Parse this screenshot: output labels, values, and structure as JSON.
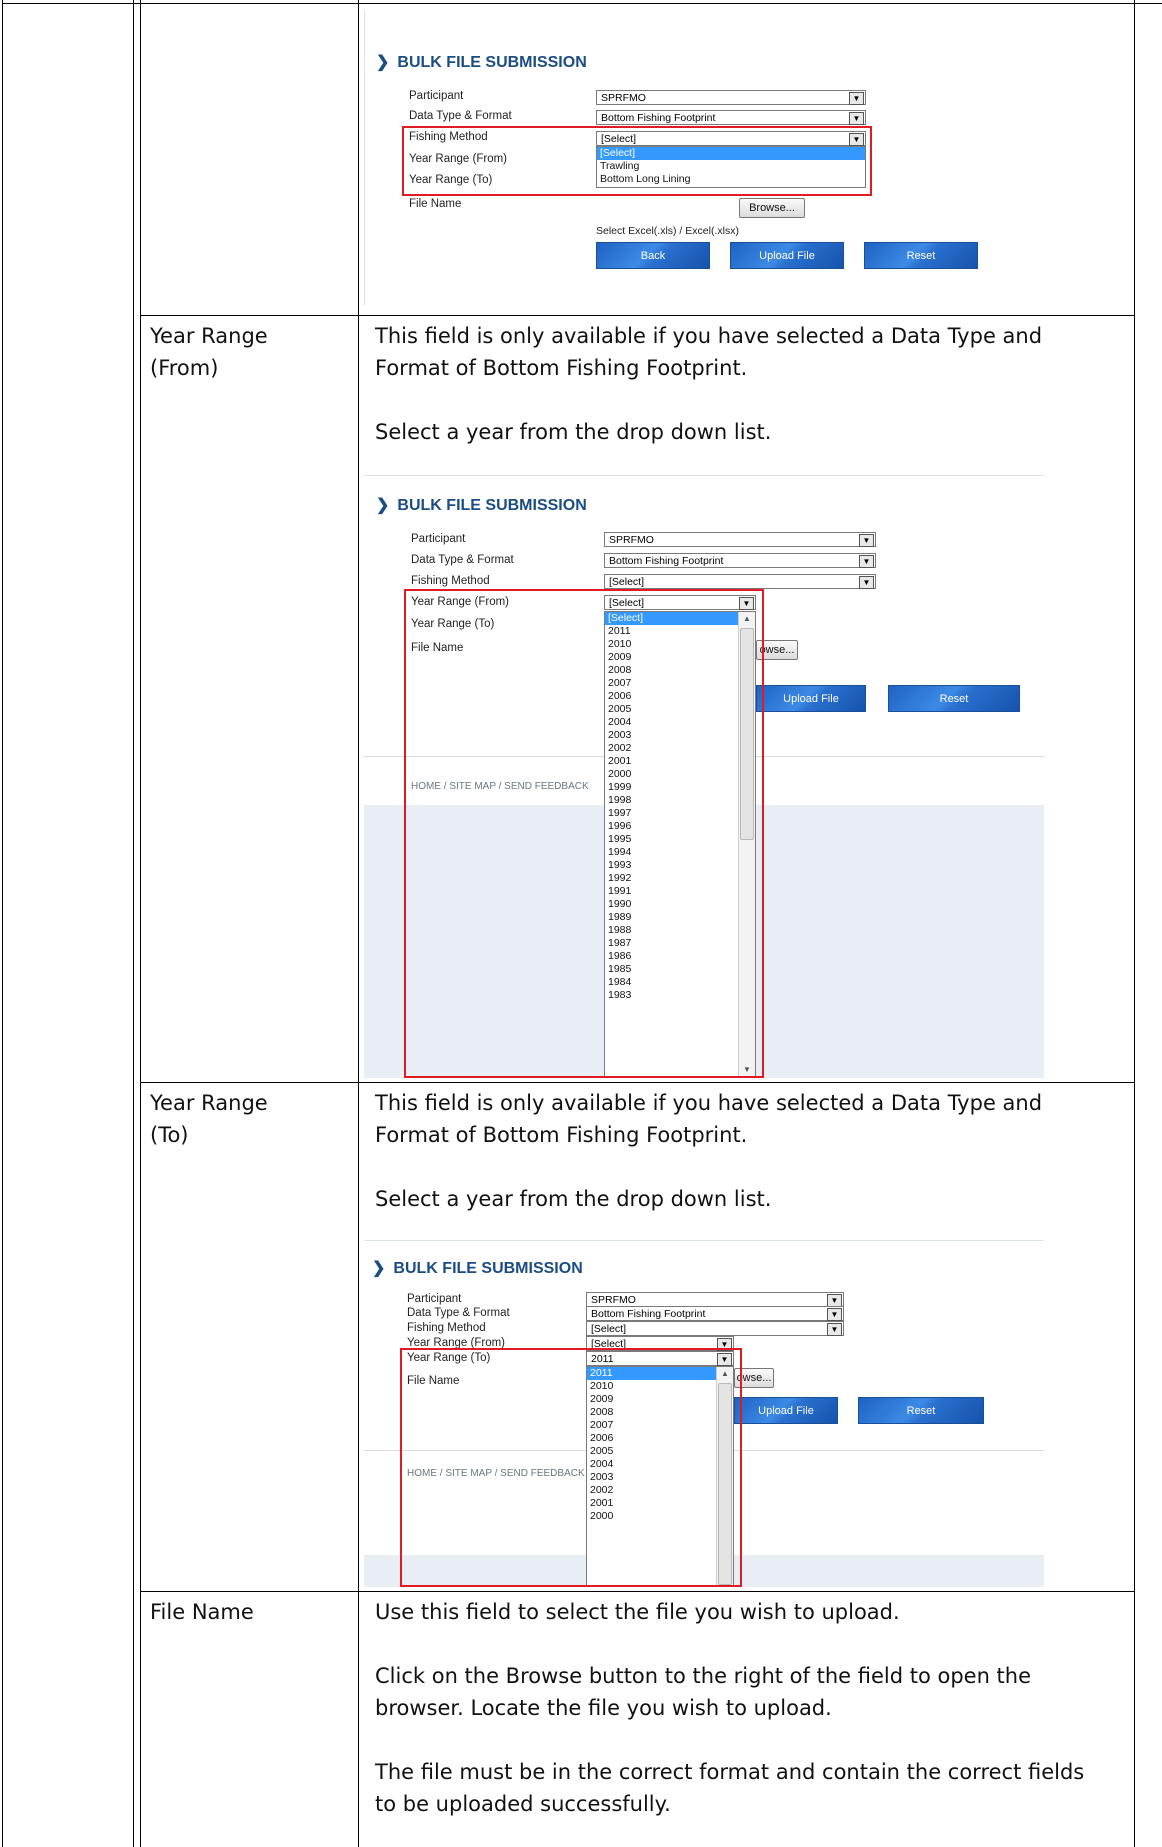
{
  "shots": {
    "common": {
      "title": "BULK FILE SUBMISSION",
      "chevron": "chevron-right-icon",
      "participant_label": "Participant",
      "participant_value": "SPRFMO",
      "datatype_label": "Data Type & Format",
      "datatype_value": "Bottom Fishing Footprint",
      "fishing_label": "Fishing Method",
      "from_label": "Year Range (From)",
      "to_label": "Year Range (To)",
      "file_label": "File Name",
      "browse": "Browse...",
      "browse_partial": "owse...",
      "hint": "Select Excel(.xls) / Excel(.xlsx)",
      "back": "Back",
      "upload": "Upload File",
      "reset": "Reset",
      "footer": "HOME / SITE MAP / SEND FEEDBACK",
      "select_placeholder": "[Select]"
    },
    "fishing_options": [
      "[Select]",
      "Trawling",
      "Bottom Long Lining"
    ],
    "from_selected": "[Select]",
    "from_options": [
      "[Select]",
      "2011",
      "2010",
      "2009",
      "2008",
      "2007",
      "2006",
      "2005",
      "2004",
      "2003",
      "2002",
      "2001",
      "2000",
      "1999",
      "1998",
      "1997",
      "1996",
      "1995",
      "1994",
      "1993",
      "1992",
      "1991",
      "1990",
      "1989",
      "1988",
      "1987",
      "1986",
      "1985",
      "1984",
      "1983"
    ],
    "to_selected": "2011",
    "to_options": [
      "2011",
      "2010",
      "2009",
      "2008",
      "2007",
      "2006",
      "2005",
      "2004",
      "2003",
      "2002",
      "2001",
      "2000"
    ]
  },
  "rows": [
    {
      "field": "Year Range\n(From)",
      "p1": "This field is only available if you have selected a Data Type and Format of Bottom Fishing Footprint.",
      "p2": "Select a year from the drop down list."
    },
    {
      "field": "Year Range\n(To)",
      "p1": "This field is only available if you have selected a Data Type and Format of Bottom Fishing Footprint.",
      "p2": "Select a year from the drop down list."
    },
    {
      "field": "File Name",
      "p1": "Use this field to select the file you wish to upload.",
      "p2": "Click on the Browse button to the right of the field to open the browser. Locate the file you wish to upload.",
      "p3": "The file must be in the correct format and contain the correct fields to be uploaded successfully."
    }
  ]
}
